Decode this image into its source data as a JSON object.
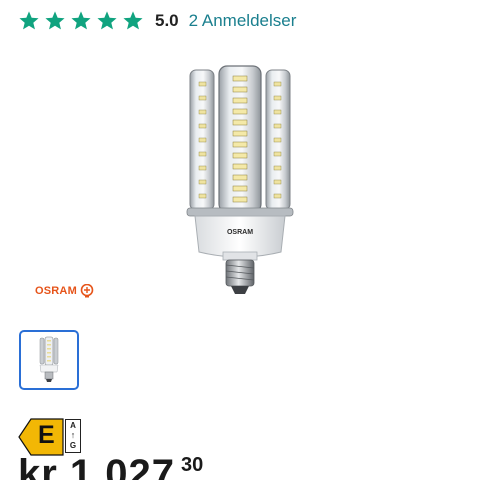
{
  "rating": {
    "stars": 5,
    "max_stars": 5,
    "star_color": "#10a37f",
    "score": "5.0",
    "reviews_label": "2 Anmeldelser",
    "link_color": "#1a7f8e"
  },
  "product": {
    "image_icon": "led-corn-bulb-icon",
    "bulb_label": "OSRAM"
  },
  "brand": {
    "name": "OSRAM",
    "color": "#e6541a",
    "icon": "osram-bulb-logo-icon"
  },
  "gallery": {
    "thumbnails": [
      {
        "icon": "led-corn-bulb-thumbnail-icon",
        "selected": true
      }
    ],
    "selected_border_color": "#2a6fd6"
  },
  "energy_label": {
    "class": "E",
    "scale_top": "A",
    "scale_arrow": "↑",
    "scale_bottom": "G",
    "color": "#f2b705"
  },
  "price": {
    "main": "kr 1 027",
    "cents": "30"
  }
}
